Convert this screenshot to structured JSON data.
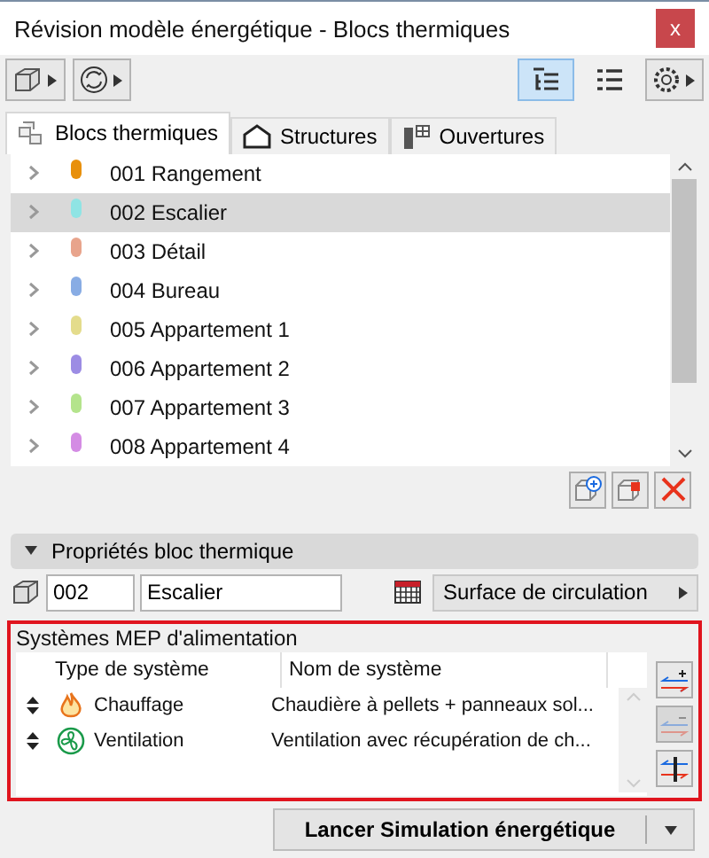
{
  "window": {
    "title": "Révision modèle énergétique - Blocs thermiques",
    "close_label": "x"
  },
  "toolbar": {
    "views": [
      {
        "kind": "tree",
        "selected": true
      },
      {
        "kind": "list",
        "selected": false
      }
    ]
  },
  "tabs": [
    {
      "label": "Blocs thermiques",
      "kind": "blocks",
      "selected": true
    },
    {
      "label": "Structures",
      "kind": "structures",
      "selected": false
    },
    {
      "label": "Ouvertures",
      "kind": "openings",
      "selected": false
    }
  ],
  "blocks": [
    {
      "label": "001 Rangement",
      "color": "#e8900c",
      "selected": false
    },
    {
      "label": "002 Escalier",
      "color": "#8fe4e4",
      "selected": true
    },
    {
      "label": "003 Détail",
      "color": "#e8a48c",
      "selected": false
    },
    {
      "label": "004 Bureau",
      "color": "#88ace4",
      "selected": false
    },
    {
      "label": "005 Appartement 1",
      "color": "#e4dc8c",
      "selected": false
    },
    {
      "label": "006 Appartement 2",
      "color": "#9c8ce4",
      "selected": false
    },
    {
      "label": "007 Appartement 3",
      "color": "#b4e48c",
      "selected": false
    },
    {
      "label": "008 Appartement 4",
      "color": "#d48ce4",
      "selected": false
    }
  ],
  "properties": {
    "header": "Propriétés bloc thermique",
    "expanded": true,
    "number": "002",
    "name": "Escalier",
    "surface": "Surface de circulation"
  },
  "mep": {
    "title": "Systèmes MEP d'alimentation",
    "columns": [
      "Type de système",
      "Nom de système"
    ],
    "rows": [
      {
        "kind": "heating",
        "type": "Chauffage",
        "name": "Chaudière à pellets + panneaux sol..."
      },
      {
        "kind": "ventilation",
        "type": "Ventilation",
        "name": "Ventilation avec récupération de ch..."
      }
    ],
    "remove_disabled": true
  },
  "run_button": "Lancer Simulation énergétique"
}
